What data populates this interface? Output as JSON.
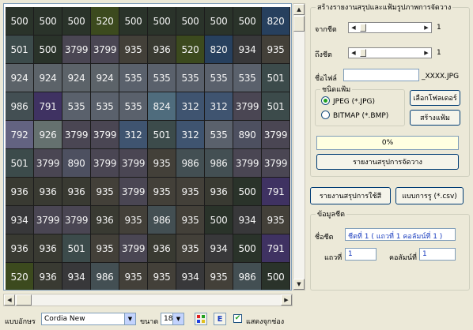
{
  "grid": {
    "rows": [
      [
        {
          "v": "500",
          "c": "#2a332a"
        },
        {
          "v": "500",
          "c": "#2a332a"
        },
        {
          "v": "500",
          "c": "#2a332a"
        },
        {
          "v": "520",
          "c": "#3c4a1e"
        },
        {
          "v": "500",
          "c": "#2a332a"
        },
        {
          "v": "500",
          "c": "#2a332a"
        },
        {
          "v": "500",
          "c": "#2a332a"
        },
        {
          "v": "500",
          "c": "#2a332a"
        },
        {
          "v": "500",
          "c": "#2a332a"
        },
        {
          "v": "820",
          "c": "#27405e"
        }
      ],
      [
        {
          "v": "501",
          "c": "#3c4b4b"
        },
        {
          "v": "500",
          "c": "#2a332a"
        },
        {
          "v": "3799",
          "c": "#4a4653"
        },
        {
          "v": "3799",
          "c": "#4a4653"
        },
        {
          "v": "935",
          "c": "#434039"
        },
        {
          "v": "936",
          "c": "#393a32"
        },
        {
          "v": "520",
          "c": "#3c4a1e"
        },
        {
          "v": "820",
          "c": "#27405e"
        },
        {
          "v": "934",
          "c": "#38383a"
        },
        {
          "v": "935",
          "c": "#434039"
        }
      ],
      [
        {
          "v": "924",
          "c": "#5c6369"
        },
        {
          "v": "924",
          "c": "#5c6369"
        },
        {
          "v": "924",
          "c": "#5c6369"
        },
        {
          "v": "924",
          "c": "#5c6369"
        },
        {
          "v": "535",
          "c": "#5a616c"
        },
        {
          "v": "535",
          "c": "#5a616c"
        },
        {
          "v": "535",
          "c": "#5a616c"
        },
        {
          "v": "535",
          "c": "#5a616c"
        },
        {
          "v": "535",
          "c": "#5a616c"
        },
        {
          "v": "501",
          "c": "#3c4b4b"
        }
      ],
      [
        {
          "v": "986",
          "c": "#434f53"
        },
        {
          "v": "791",
          "c": "#3f3262"
        },
        {
          "v": "535",
          "c": "#5a616c"
        },
        {
          "v": "535",
          "c": "#5a616c"
        },
        {
          "v": "535",
          "c": "#5a616c"
        },
        {
          "v": "824",
          "c": "#4f6c7d"
        },
        {
          "v": "312",
          "c": "#3f5470"
        },
        {
          "v": "312",
          "c": "#3f5470"
        },
        {
          "v": "3799",
          "c": "#4a4653"
        },
        {
          "v": "501",
          "c": "#3c4b4b"
        }
      ],
      [
        {
          "v": "792",
          "c": "#636381"
        },
        {
          "v": "926",
          "c": "#65716f"
        },
        {
          "v": "3799",
          "c": "#4a4653"
        },
        {
          "v": "3799",
          "c": "#4a4653"
        },
        {
          "v": "312",
          "c": "#3f5470"
        },
        {
          "v": "501",
          "c": "#3c4b4b"
        },
        {
          "v": "312",
          "c": "#3f5470"
        },
        {
          "v": "535",
          "c": "#5a616c"
        },
        {
          "v": "890",
          "c": "#4d5060"
        },
        {
          "v": "3799",
          "c": "#4a4653"
        }
      ],
      [
        {
          "v": "501",
          "c": "#3c4b4b"
        },
        {
          "v": "3799",
          "c": "#4a4653"
        },
        {
          "v": "890",
          "c": "#4d5060"
        },
        {
          "v": "3799",
          "c": "#4a4653"
        },
        {
          "v": "3799",
          "c": "#4a4653"
        },
        {
          "v": "935",
          "c": "#434039"
        },
        {
          "v": "986",
          "c": "#434f53"
        },
        {
          "v": "986",
          "c": "#434f53"
        },
        {
          "v": "3799",
          "c": "#4a4653"
        },
        {
          "v": "3799",
          "c": "#4a4653"
        }
      ],
      [
        {
          "v": "936",
          "c": "#393a32"
        },
        {
          "v": "936",
          "c": "#393a32"
        },
        {
          "v": "936",
          "c": "#393a32"
        },
        {
          "v": "935",
          "c": "#434039"
        },
        {
          "v": "3799",
          "c": "#4a4653"
        },
        {
          "v": "935",
          "c": "#434039"
        },
        {
          "v": "935",
          "c": "#434039"
        },
        {
          "v": "936",
          "c": "#393a32"
        },
        {
          "v": "500",
          "c": "#2a332a"
        },
        {
          "v": "791",
          "c": "#3f3262"
        }
      ],
      [
        {
          "v": "934",
          "c": "#38383a"
        },
        {
          "v": "3799",
          "c": "#4a4653"
        },
        {
          "v": "3799",
          "c": "#4a4653"
        },
        {
          "v": "936",
          "c": "#393a32"
        },
        {
          "v": "935",
          "c": "#434039"
        },
        {
          "v": "986",
          "c": "#434f53"
        },
        {
          "v": "935",
          "c": "#434039"
        },
        {
          "v": "500",
          "c": "#2a332a"
        },
        {
          "v": "934",
          "c": "#38383a"
        },
        {
          "v": "935",
          "c": "#434039"
        }
      ],
      [
        {
          "v": "936",
          "c": "#393a32"
        },
        {
          "v": "936",
          "c": "#393a32"
        },
        {
          "v": "501",
          "c": "#3c4b4b"
        },
        {
          "v": "935",
          "c": "#434039"
        },
        {
          "v": "3799",
          "c": "#4a4653"
        },
        {
          "v": "936",
          "c": "#393a32"
        },
        {
          "v": "935",
          "c": "#434039"
        },
        {
          "v": "934",
          "c": "#38383a"
        },
        {
          "v": "500",
          "c": "#2a332a"
        },
        {
          "v": "791",
          "c": "#3f3262"
        }
      ],
      [
        {
          "v": "520",
          "c": "#3c4a1e"
        },
        {
          "v": "936",
          "c": "#393a32"
        },
        {
          "v": "934",
          "c": "#38383a"
        },
        {
          "v": "986",
          "c": "#434f53"
        },
        {
          "v": "935",
          "c": "#434039"
        },
        {
          "v": "935",
          "c": "#434039"
        },
        {
          "v": "934",
          "c": "#38383a"
        },
        {
          "v": "935",
          "c": "#434039"
        },
        {
          "v": "986",
          "c": "#434f53"
        },
        {
          "v": "500",
          "c": "#2a332a"
        }
      ]
    ]
  },
  "panel": {
    "report_group_title": "สร้างรายงานสรุปและแฟ้มรูปภาพการจัดวาง",
    "from_sheet_label": "จากชีต",
    "from_sheet_value": "1",
    "to_sheet_label": "ถึงชีต",
    "to_sheet_value": "1",
    "filename_label": "ชื่อไฟล์",
    "filename_value": "",
    "filename_suffix": "_XXXX.JPG",
    "filetype_group_title": "ชนิดแฟ้ม",
    "jpeg_option": "JPEG (*.JPG)",
    "bmp_option": "BITMAP (*.BMP)",
    "choose_folder_button": "เลือกโฟลเดอร์",
    "create_file_button": "สร้างแฟ้ม",
    "progress_text": "0%",
    "layout_summary_button": "รายงานสรุปการจัดวาง",
    "color_usage_button": "รายงานสรุปการใช้สี",
    "csv_format_button": "แบบการรู (*.csv)",
    "sheet_info_title": "ข้อมูลชีต",
    "sheet_name_label": "ชื่อชีต",
    "sheet_name_value": "ชีตที่ 1 ( แถวที่ 1 คอลัมน์ที่ 1 )",
    "row_label": "แถวที่",
    "row_value": "1",
    "col_label": "คอลัมน์ที่",
    "col_value": "1"
  },
  "bottom": {
    "font_label": "แบบอักษร",
    "font_value": "Cordia New",
    "size_label": "ขนาด",
    "size_value": "18",
    "show_grid_label": "แสดงจุกช่อง",
    "show_grid_checked": true
  },
  "colors": {
    "accent_blue": "#1a3dbf",
    "progress_bg": "#ffffe1",
    "window_bg": "#ece9d8"
  },
  "icons": {
    "palette": "palette-icon",
    "e_format": "e-format-icon"
  }
}
